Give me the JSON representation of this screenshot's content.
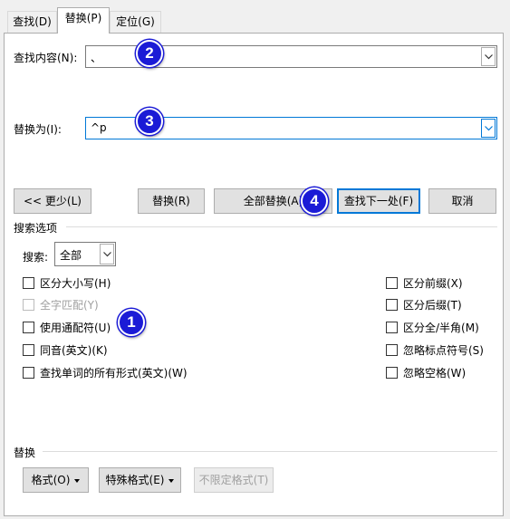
{
  "tabs": [
    {
      "label": "查找(D)",
      "active": false
    },
    {
      "label": "替换(P)",
      "active": true
    },
    {
      "label": "定位(G)",
      "active": false
    }
  ],
  "find": {
    "label": "查找内容(N):",
    "value": "、"
  },
  "replace": {
    "label": "替换为(I):",
    "value": "^p"
  },
  "buttons": {
    "less": "<< 更少(L)",
    "replace": "替换(R)",
    "replace_all": "全部替换(A)",
    "find_next": "查找下一处(F)",
    "cancel": "取消"
  },
  "search_options": {
    "title": "搜索选项",
    "search_label": "搜索:",
    "search_value": "全部",
    "left_options": [
      {
        "label": "区分大小写(H)",
        "checked": false,
        "disabled": false
      },
      {
        "label": "全字匹配(Y)",
        "checked": false,
        "disabled": true
      },
      {
        "label": "使用通配符(U)",
        "checked": false,
        "disabled": false
      },
      {
        "label": "同音(英文)(K)",
        "checked": false,
        "disabled": false
      },
      {
        "label": "查找单词的所有形式(英文)(W)",
        "checked": false,
        "disabled": false
      }
    ],
    "right_options": [
      {
        "label": "区分前缀(X)",
        "checked": false
      },
      {
        "label": "区分后缀(T)",
        "checked": false
      },
      {
        "label": "区分全/半角(M)",
        "checked": false
      },
      {
        "label": "忽略标点符号(S)",
        "checked": false
      },
      {
        "label": "忽略空格(W)",
        "checked": false
      }
    ]
  },
  "replace_section": {
    "title": "替换",
    "format": "格式(O)",
    "special": "特殊格式(E)",
    "no_format": "不限定格式(T)"
  },
  "badges": [
    "1",
    "2",
    "3",
    "4"
  ],
  "colors": {
    "badge": "#1b1bd6",
    "focus": "#0078d7"
  }
}
